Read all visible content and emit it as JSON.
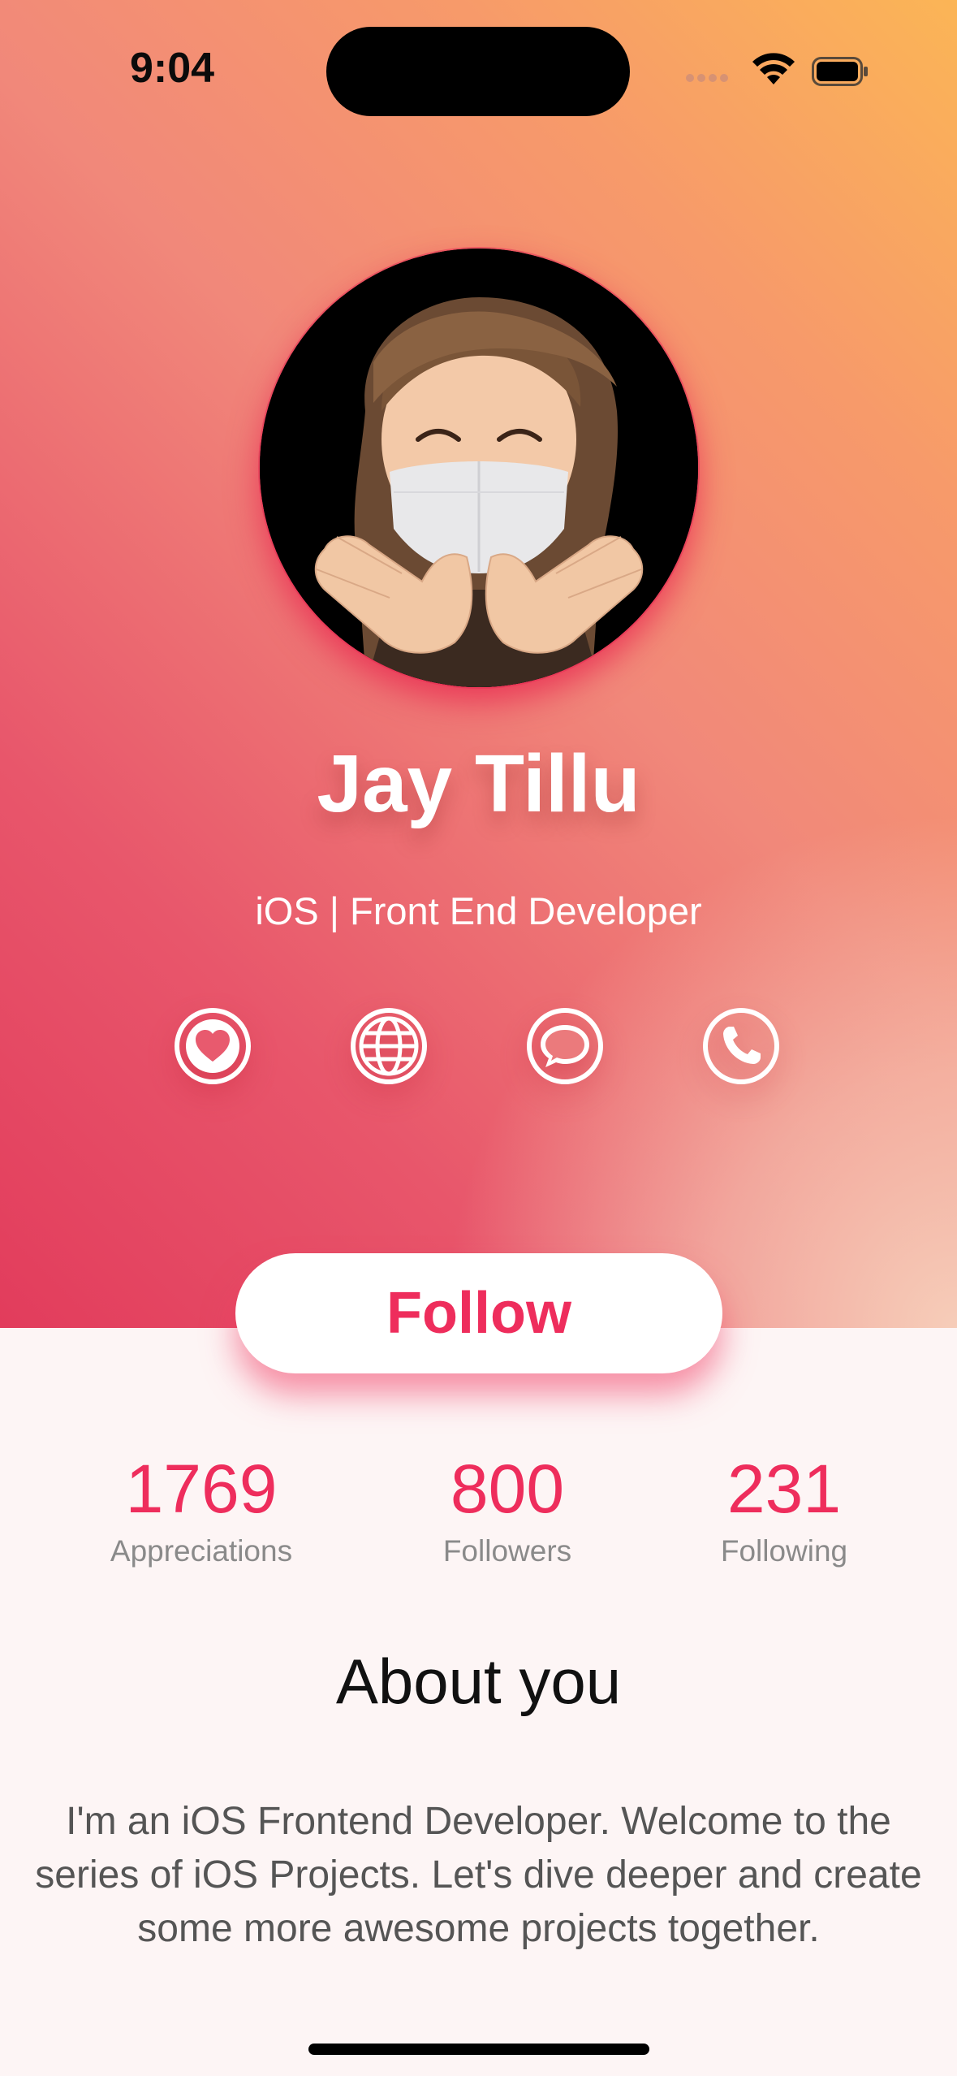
{
  "status_bar": {
    "time": "9:04"
  },
  "profile": {
    "name": "Jay Tillu",
    "role": "iOS | Front End Developer"
  },
  "actions": [
    {
      "icon": "heart-icon"
    },
    {
      "icon": "globe-icon"
    },
    {
      "icon": "message-icon"
    },
    {
      "icon": "phone-icon"
    }
  ],
  "follow_button": {
    "label": "Follow"
  },
  "stats": [
    {
      "value": "1769",
      "label": "Appreciations"
    },
    {
      "value": "800",
      "label": "Followers"
    },
    {
      "value": "231",
      "label": "Following"
    }
  ],
  "about": {
    "title": "About you",
    "text": "I'm an iOS Frontend Developer. Welcome to the series of iOS Projects. Let's dive deeper and create some more awesome projects together."
  },
  "colors": {
    "accent": "#ee2d5c",
    "gradient_start": "#e23c5c",
    "gradient_end": "#fbb556",
    "background": "#fdf5f5"
  }
}
